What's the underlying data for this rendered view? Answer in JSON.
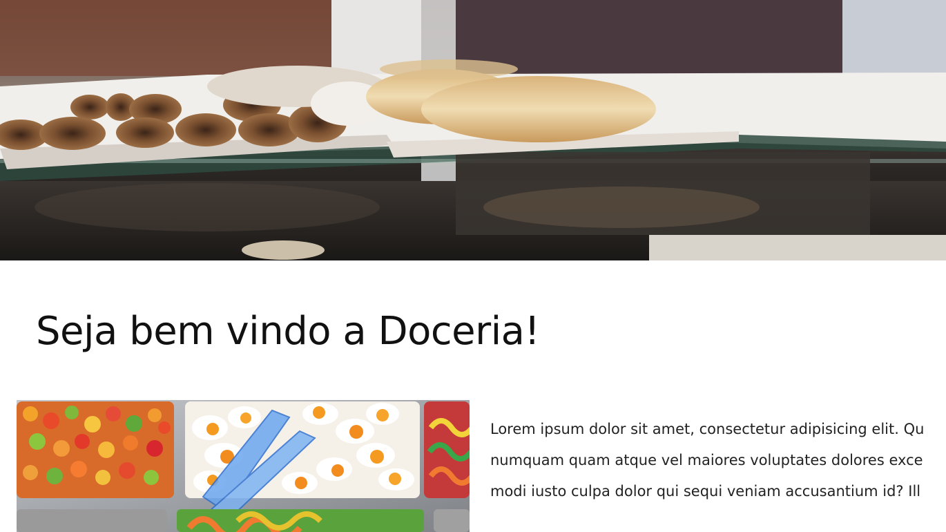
{
  "hero": {
    "image": "bakery-display-case-pastries"
  },
  "main": {
    "title": "Seja bem vindo a Doceria!",
    "image": "candy-bins-gummies",
    "paragraph_lines": [
      "Lorem ipsum dolor sit amet, consectetur adipisicing elit. Qu",
      "numquam quam atque vel maiores voluptates dolores exce",
      "modi iusto culpa dolor qui sequi veniam accusantium id? Ill"
    ]
  }
}
